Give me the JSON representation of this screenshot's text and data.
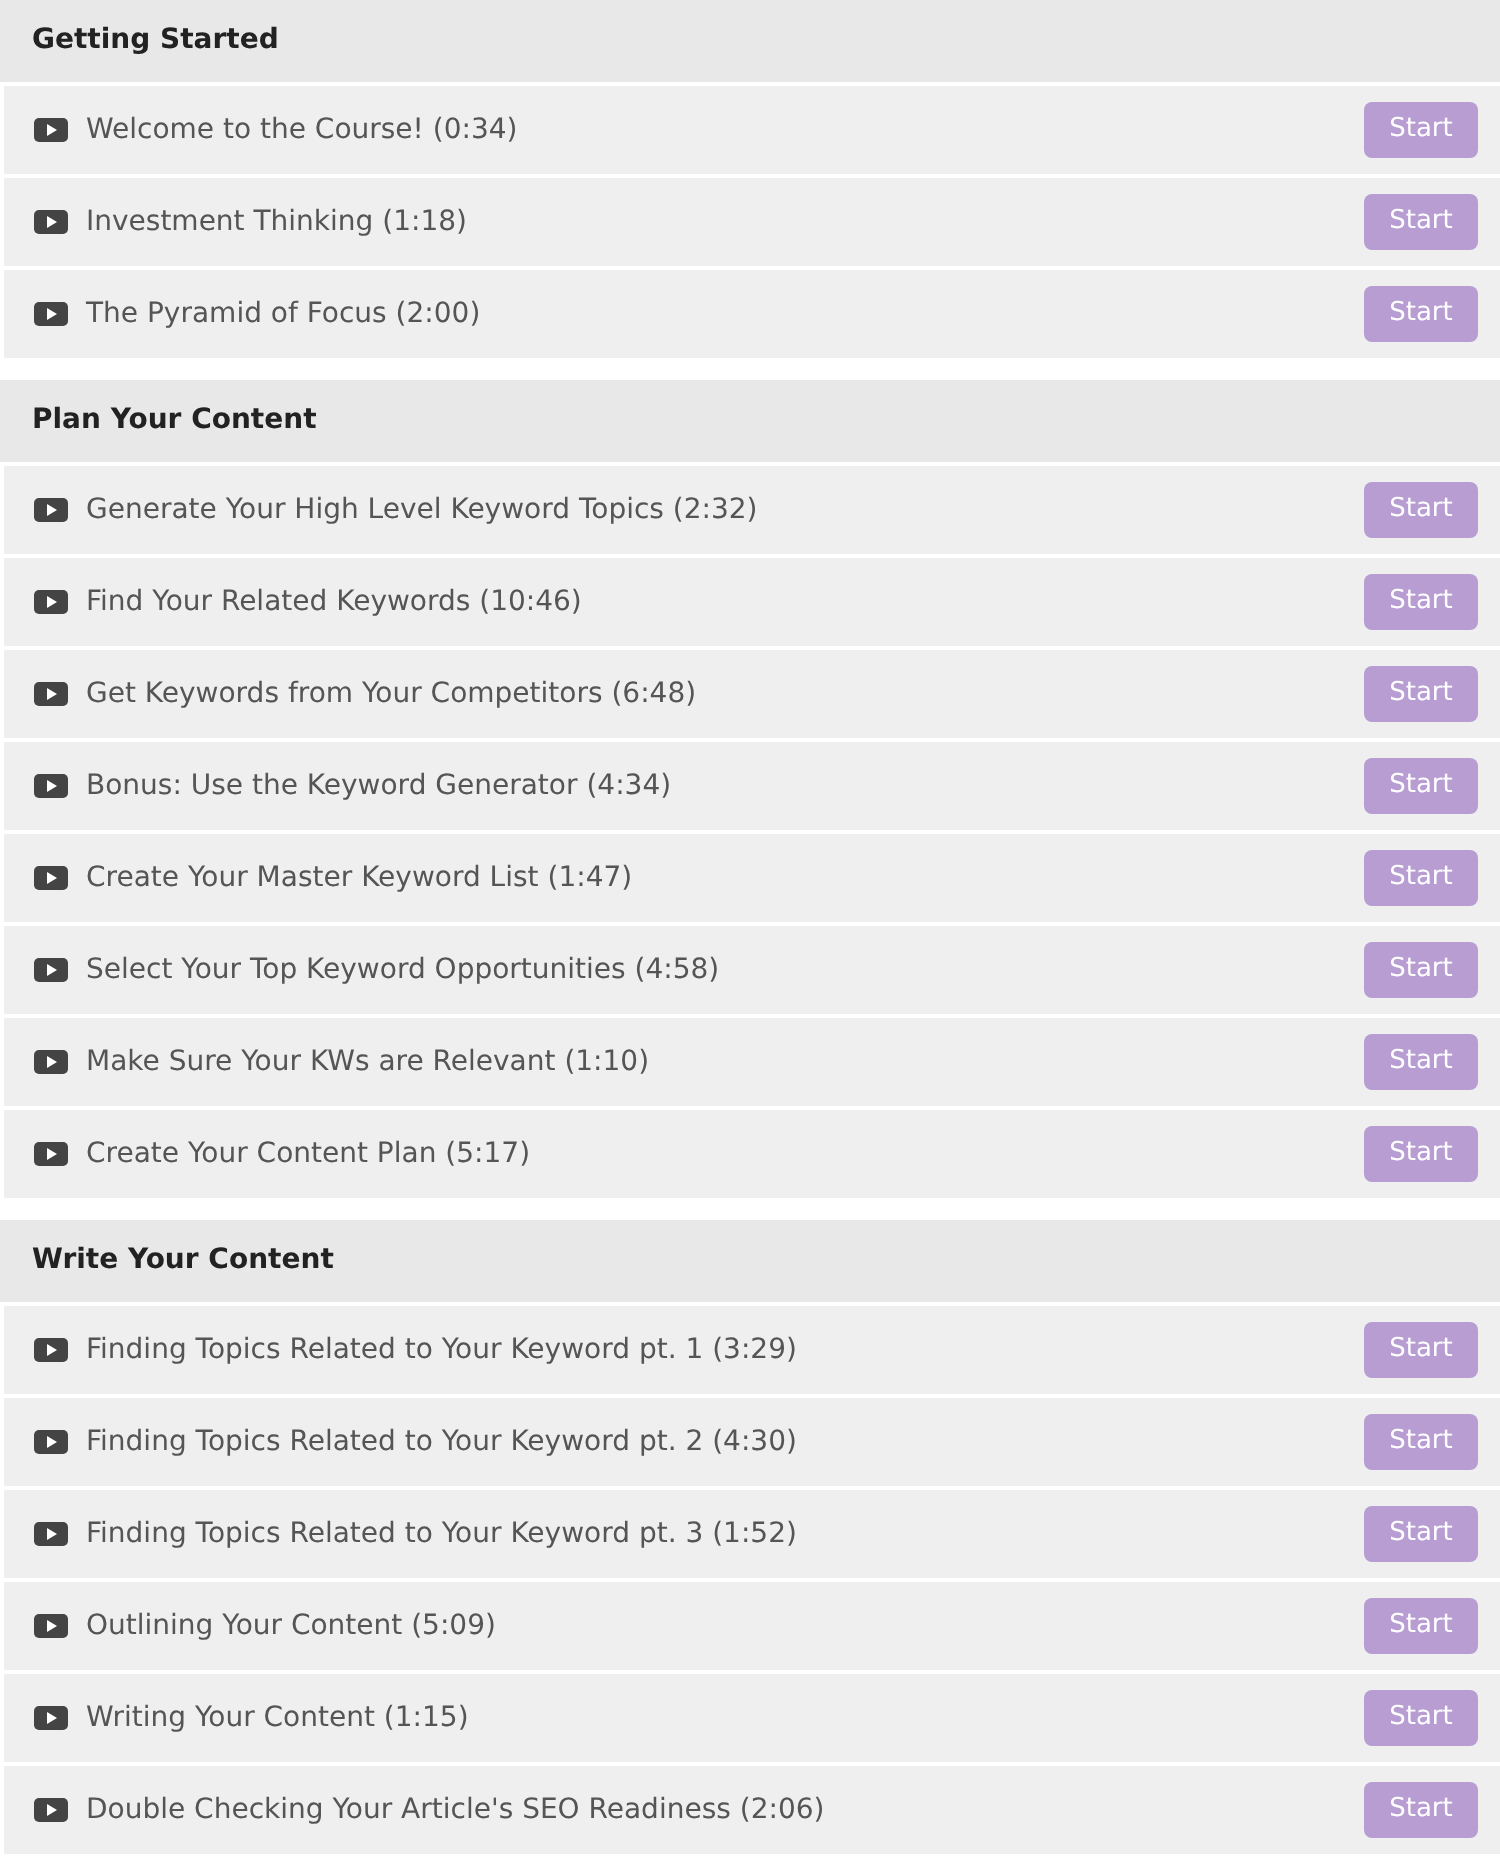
{
  "sections": [
    {
      "title": "Getting Started",
      "lessons": [
        {
          "title": "Welcome to the Course! (0:34)",
          "button": "Start"
        },
        {
          "title": "Investment Thinking (1:18)",
          "button": "Start"
        },
        {
          "title": "The Pyramid of Focus (2:00)",
          "button": "Start"
        }
      ]
    },
    {
      "title": "Plan Your Content",
      "lessons": [
        {
          "title": "Generate Your High Level Keyword Topics (2:32)",
          "button": "Start"
        },
        {
          "title": "Find Your Related Keywords (10:46)",
          "button": "Start"
        },
        {
          "title": "Get Keywords from Your Competitors (6:48)",
          "button": "Start"
        },
        {
          "title": "Bonus: Use the Keyword Generator (4:34)",
          "button": "Start"
        },
        {
          "title": "Create Your Master Keyword List (1:47)",
          "button": "Start"
        },
        {
          "title": "Select Your Top Keyword Opportunities (4:58)",
          "button": "Start"
        },
        {
          "title": "Make Sure Your KWs are Relevant (1:10)",
          "button": "Start"
        },
        {
          "title": "Create Your Content Plan (5:17)",
          "button": "Start"
        }
      ]
    },
    {
      "title": "Write Your Content",
      "lessons": [
        {
          "title": "Finding Topics Related to Your Keyword pt. 1 (3:29)",
          "button": "Start"
        },
        {
          "title": "Finding Topics Related to Your Keyword pt. 2 (4:30)",
          "button": "Start"
        },
        {
          "title": "Finding Topics Related to Your Keyword pt. 3 (1:52)",
          "button": "Start"
        },
        {
          "title": "Outlining Your Content (5:09)",
          "button": "Start"
        },
        {
          "title": "Writing Your Content (1:15)",
          "button": "Start"
        },
        {
          "title": "Double Checking Your Article's SEO Readiness (2:06)",
          "button": "Start"
        }
      ]
    }
  ]
}
